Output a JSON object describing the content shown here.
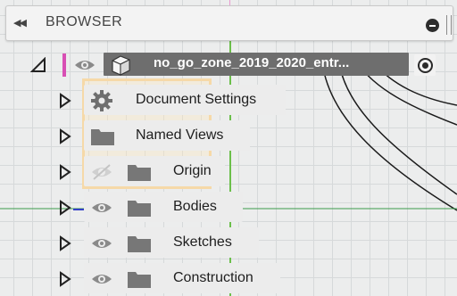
{
  "browser": {
    "title": "BROWSER",
    "collapse_icon": "double-left-arrow-icon",
    "root": {
      "label": "no_go_zone_2019_2020_entr...",
      "icon": "component-cube-icon",
      "eye_icon": "eye-icon",
      "radio_icon": "activate-radio-icon"
    },
    "items": [
      {
        "label": "Document Settings",
        "icon": "gear-icon"
      },
      {
        "label": "Named Views",
        "icon": "folder-icon"
      },
      {
        "label": "Origin",
        "icon": "folder-icon",
        "eye_state": "hidden"
      },
      {
        "label": "Bodies",
        "icon": "folder-icon",
        "eye_state": "visible"
      },
      {
        "label": "Sketches",
        "icon": "folder-icon",
        "eye_state": "visible"
      },
      {
        "label": "Construction",
        "icon": "folder-icon",
        "eye_state": "visible"
      }
    ]
  },
  "colors": {
    "panel_bg": "#f3f3f3",
    "root_label_bg": "#6e6e6e",
    "active_marker": "#d84fb4",
    "selection_outline": "#f6d9a8",
    "y_axis": "#6bbf4a",
    "x_axis": "#3440c8"
  }
}
